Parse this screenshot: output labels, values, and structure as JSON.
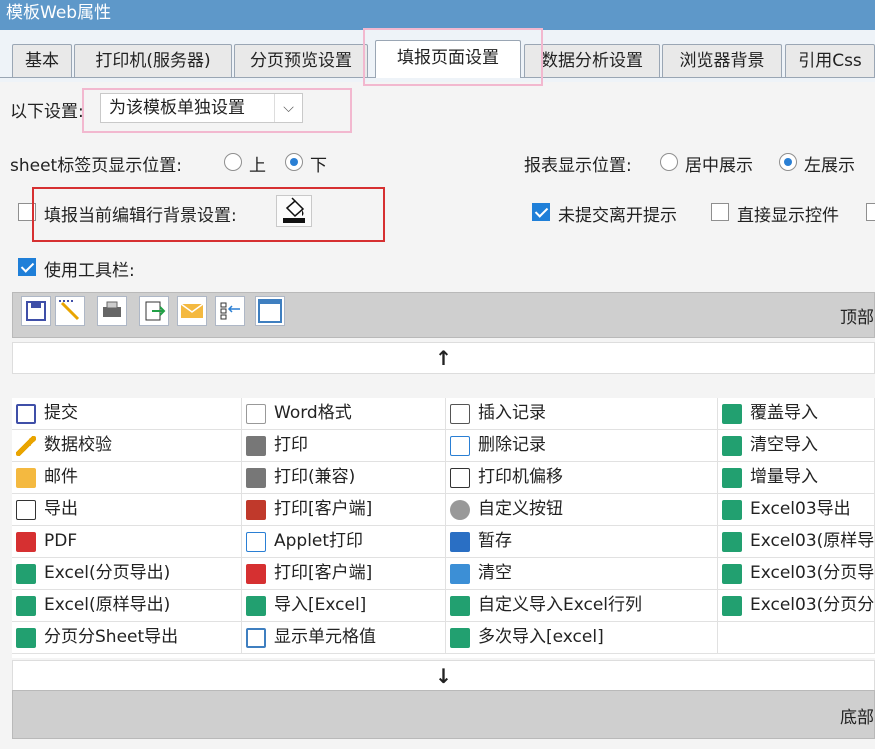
{
  "window": {
    "title": "模板Web属性"
  },
  "tabs": [
    {
      "label": "基本"
    },
    {
      "label": "打印机(服务器)"
    },
    {
      "label": "分页预览设置"
    },
    {
      "label": "填报页面设置",
      "active": true
    },
    {
      "label": "数据分析设置"
    },
    {
      "label": "浏览器背景"
    },
    {
      "label": "引用Css"
    }
  ],
  "settings": {
    "mode_label": "以下设置:",
    "mode_value": "为该模板单独设置",
    "sheet_position_label": "sheet标签页显示位置:",
    "sheet_position_options": [
      "上",
      "下"
    ],
    "sheet_position_selected": "下",
    "report_position_label": "报表显示位置:",
    "report_position_options": [
      "居中展示",
      "左展示"
    ],
    "report_position_selected": "左展示",
    "row_bg_label": "填报当前编辑行背景设置:",
    "row_bg_checked": false,
    "leave_prompt_label": "未提交离开提示",
    "leave_prompt_checked": true,
    "direct_show_label": "直接显示控件",
    "direct_show_checked": false,
    "use_toolbar_label": "使用工具栏:",
    "use_toolbar_checked": true
  },
  "toolbar": {
    "top_label": "顶部",
    "bottom_label": "底部",
    "up_arrow": "↑",
    "down_arrow": "↓",
    "icons": [
      "save-icon",
      "pencil-icon",
      "printer-icon",
      "export-icon",
      "mail-icon",
      "insert-record-icon",
      "blank-cell-icon"
    ]
  },
  "buttons": {
    "col1": [
      "提交",
      "数据校验",
      "邮件",
      "导出",
      "PDF",
      "Excel(分页导出)",
      "Excel(原样导出)",
      "分页分Sheet导出"
    ],
    "col2": [
      "Word格式",
      "打印",
      "打印(兼容)",
      "打印[客户端]",
      "Applet打印",
      "打印[客户端]",
      "导入[Excel]",
      "显示单元格值"
    ],
    "col3": [
      "插入记录",
      "删除记录",
      "打印机偏移",
      "自定义按钮",
      "暂存",
      "清空",
      "自定义导入Excel行列",
      "多次导入[excel]"
    ],
    "col4": [
      "覆盖导入",
      "清空导入",
      "增量导入",
      "Excel03导出",
      "Excel03(原样导",
      "Excel03(分页导",
      "Excel03(分页分",
      ""
    ]
  },
  "colors": {
    "titlebar": "#5e98c9",
    "accent": "#2a7fd4",
    "highlight_pink": "#f2b8cf",
    "highlight_red": "#d63031"
  }
}
